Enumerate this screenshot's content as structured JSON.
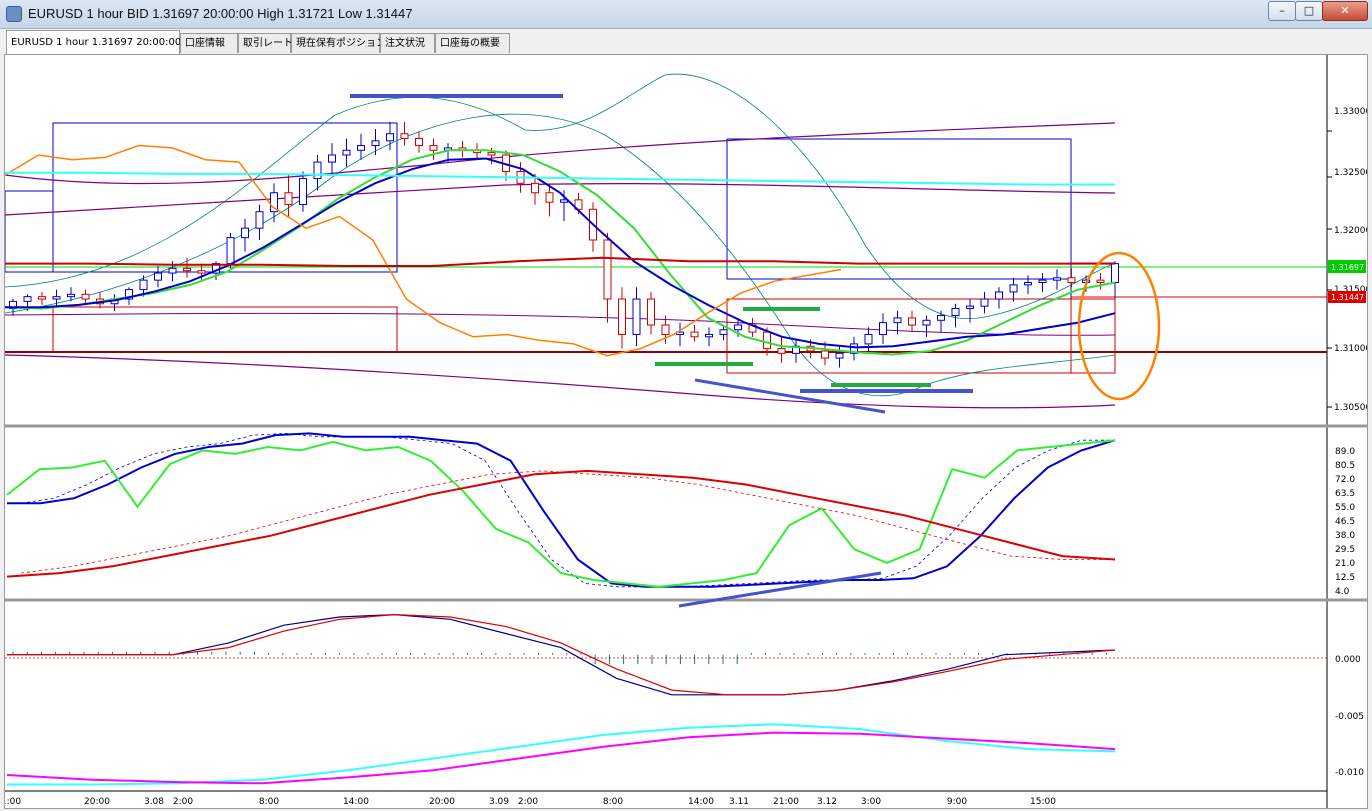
{
  "window": {
    "title": "EURUSD 1 hour BID 1.31697 20:00:00 High 1.31721 Low 1.31447",
    "minimize_label": "–",
    "maximize_label": "□",
    "close_label": "✕"
  },
  "tabs": [
    {
      "label": "EURUSD 1 hour 1.31697 20:00:00",
      "active": true
    },
    {
      "label": "口座情報",
      "active": false
    },
    {
      "label": "取引レート",
      "active": false
    },
    {
      "label": "現在保有ポジション",
      "active": false
    },
    {
      "label": "注文状況",
      "active": false
    },
    {
      "label": "口座毎の概要",
      "active": false
    }
  ],
  "price_axis": {
    "ticks": [
      "1.33000",
      "1.32500",
      "1.32000",
      "1.31500",
      "1.31000",
      "1.30500"
    ],
    "current_price_label": "1.31697",
    "low_price_label": "1.31447",
    "current_price_color": "#00cc00",
    "low_price_color": "#dd0000"
  },
  "stoch_axis": {
    "ticks": [
      "89.0",
      "80.5",
      "72.0",
      "63.5",
      "55.0",
      "46.5",
      "38.0",
      "29.5",
      "21.0",
      "12.5",
      "4.0"
    ]
  },
  "macd_axis": {
    "ticks": [
      "0.000",
      "-0.005",
      "-0.010"
    ]
  },
  "time_axis": {
    "labels": [
      "1:00",
      "20:00",
      "3.08",
      "2:00",
      "8:00",
      "14:00",
      "20:00",
      "3.09",
      "2:00",
      "8:00",
      "14:00",
      "3.11",
      "21:00",
      "3.12",
      "3:00",
      "9:00",
      "15:00"
    ]
  },
  "chart_data": [
    {
      "type": "candlestick",
      "title": "EURUSD 1 hour",
      "ylim": [
        1.3035,
        1.3345
      ],
      "series": [
        {
          "name": "ma-green",
          "color": "#33dd33",
          "values": [
            1.3133,
            1.3132,
            1.3135,
            1.314,
            1.3145,
            1.3152,
            1.3163,
            1.3182,
            1.3202,
            1.3225,
            1.3243,
            1.3258,
            1.3266,
            1.3266,
            1.3262,
            1.3248,
            1.3228,
            1.32,
            1.316,
            1.3124,
            1.3108,
            1.31,
            1.3098,
            1.3095,
            1.3093,
            1.3096,
            1.3105,
            1.312,
            1.3135,
            1.3148,
            1.3154
          ]
        },
        {
          "name": "ma-blue",
          "color": "#0000cc",
          "values": [
            1.3133,
            1.3133,
            1.3135,
            1.3139,
            1.3146,
            1.3155,
            1.3168,
            1.3184,
            1.3203,
            1.3222,
            1.3238,
            1.325,
            1.3258,
            1.3259,
            1.325,
            1.323,
            1.32,
            1.3172,
            1.3152,
            1.3135,
            1.312,
            1.3108,
            1.3102,
            1.3099,
            1.31,
            1.3104,
            1.3108,
            1.311,
            1.3115,
            1.312,
            1.3128
          ]
        },
        {
          "name": "orange-line",
          "color": "#ff8000",
          "values": [
            1.3245,
            1.3262,
            1.3258,
            1.326,
            1.327,
            1.3268,
            1.3258,
            1.3256,
            1.3218,
            1.32,
            1.321,
            1.319,
            1.314,
            1.312,
            1.3108,
            1.311,
            1.3105,
            1.3102,
            1.3092,
            1.3098,
            1.311,
            1.3128,
            1.3145,
            1.3155,
            1.316,
            1.3165
          ]
        },
        {
          "name": "cyan-level",
          "color": "#33ffff",
          "values": [
            1.3247,
            1.3247,
            1.3246,
            1.3246,
            1.3245,
            1.3244,
            1.3243,
            1.3242,
            1.3241,
            1.324,
            1.3239,
            1.3238,
            1.3237,
            1.3237
          ]
        },
        {
          "name": "red-level",
          "color": "#cc0000",
          "values": [
            1.317,
            1.317,
            1.3169,
            1.3169,
            1.3168,
            1.3168,
            1.3172,
            1.3175,
            1.3172,
            1.3172,
            1.317,
            1.317,
            1.317,
            1.317
          ]
        }
      ],
      "candles": [
        [
          1.3132,
          1.314,
          1.3126,
          1.3138
        ],
        [
          1.3138,
          1.3144,
          1.313,
          1.3142
        ],
        [
          1.3142,
          1.3146,
          1.3135,
          1.314
        ],
        [
          1.314,
          1.3148,
          1.3134,
          1.3142
        ],
        [
          1.3142,
          1.315,
          1.3138,
          1.3144
        ],
        [
          1.3144,
          1.3148,
          1.3136,
          1.314
        ],
        [
          1.314,
          1.3146,
          1.3132,
          1.3136
        ],
        [
          1.3136,
          1.3144,
          1.313,
          1.314
        ],
        [
          1.314,
          1.315,
          1.3135,
          1.3148
        ],
        [
          1.3148,
          1.316,
          1.3142,
          1.3156
        ],
        [
          1.3156,
          1.3168,
          1.315,
          1.3162
        ],
        [
          1.3162,
          1.3172,
          1.3155,
          1.3166
        ],
        [
          1.3166,
          1.3175,
          1.3158,
          1.3164
        ],
        [
          1.3164,
          1.317,
          1.3156,
          1.3162
        ],
        [
          1.3162,
          1.3172,
          1.3156,
          1.317
        ],
        [
          1.317,
          1.3196,
          1.3166,
          1.3192
        ],
        [
          1.3192,
          1.3208,
          1.318,
          1.32
        ],
        [
          1.32,
          1.322,
          1.319,
          1.3214
        ],
        [
          1.3214,
          1.3238,
          1.3205,
          1.323
        ],
        [
          1.323,
          1.3245,
          1.321,
          1.322
        ],
        [
          1.322,
          1.3248,
          1.3214,
          1.3242
        ],
        [
          1.3242,
          1.3262,
          1.3232,
          1.3256
        ],
        [
          1.3256,
          1.3272,
          1.3245,
          1.3262
        ],
        [
          1.3262,
          1.3276,
          1.3252,
          1.3266
        ],
        [
          1.3266,
          1.328,
          1.3258,
          1.327
        ],
        [
          1.327,
          1.3284,
          1.3262,
          1.3274
        ],
        [
          1.3274,
          1.329,
          1.3266,
          1.328
        ],
        [
          1.328,
          1.329,
          1.327,
          1.3276
        ],
        [
          1.3276,
          1.3282,
          1.3264,
          1.327
        ],
        [
          1.327,
          1.3276,
          1.3258,
          1.3266
        ],
        [
          1.3266,
          1.3272,
          1.3256,
          1.3268
        ],
        [
          1.3268,
          1.3274,
          1.326,
          1.3266
        ],
        [
          1.3266,
          1.3272,
          1.3258,
          1.3264
        ],
        [
          1.3264,
          1.3268,
          1.3254,
          1.3262
        ],
        [
          1.3262,
          1.3266,
          1.324,
          1.3248
        ],
        [
          1.3248,
          1.3256,
          1.323,
          1.3238
        ],
        [
          1.3238,
          1.3246,
          1.322,
          1.323
        ],
        [
          1.323,
          1.3238,
          1.321,
          1.3222
        ],
        [
          1.3222,
          1.3232,
          1.3206,
          1.3224
        ],
        [
          1.3224,
          1.323,
          1.3212,
          1.3216
        ],
        [
          1.3216,
          1.3222,
          1.318,
          1.319
        ],
        [
          1.319,
          1.3196,
          1.312,
          1.314
        ],
        [
          1.314,
          1.315,
          1.3098,
          1.311
        ],
        [
          1.311,
          1.315,
          1.31,
          1.314
        ],
        [
          1.314,
          1.3146,
          1.311,
          1.3118
        ],
        [
          1.3118,
          1.3126,
          1.3102,
          1.311
        ],
        [
          1.311,
          1.312,
          1.31,
          1.3112
        ],
        [
          1.3112,
          1.3118,
          1.3104,
          1.3108
        ],
        [
          1.3108,
          1.3116,
          1.31,
          1.311
        ],
        [
          1.311,
          1.3118,
          1.3105,
          1.3114
        ],
        [
          1.3114,
          1.3124,
          1.3108,
          1.3118
        ],
        [
          1.3118,
          1.3124,
          1.3108,
          1.3112
        ],
        [
          1.3112,
          1.3116,
          1.3092,
          1.3098
        ],
        [
          1.3098,
          1.3108,
          1.3086,
          1.3094
        ],
        [
          1.3094,
          1.3106,
          1.3086,
          1.31
        ],
        [
          1.31,
          1.3106,
          1.309,
          1.3096
        ],
        [
          1.3096,
          1.3104,
          1.3084,
          1.309
        ],
        [
          1.309,
          1.31,
          1.3082,
          1.3094
        ],
        [
          1.3094,
          1.3108,
          1.3088,
          1.3102
        ],
        [
          1.3102,
          1.3116,
          1.3094,
          1.311
        ],
        [
          1.311,
          1.3128,
          1.3102,
          1.312
        ],
        [
          1.312,
          1.313,
          1.311,
          1.3124
        ],
        [
          1.3124,
          1.313,
          1.3112,
          1.3118
        ],
        [
          1.3118,
          1.3126,
          1.3108,
          1.3122
        ],
        [
          1.3122,
          1.313,
          1.3112,
          1.3126
        ],
        [
          1.3126,
          1.3136,
          1.3116,
          1.3132
        ],
        [
          1.3132,
          1.314,
          1.312,
          1.3134
        ],
        [
          1.3134,
          1.3146,
          1.3128,
          1.314
        ],
        [
          1.314,
          1.315,
          1.3132,
          1.3146
        ],
        [
          1.3146,
          1.3158,
          1.3138,
          1.3152
        ],
        [
          1.3152,
          1.316,
          1.3144,
          1.3154
        ],
        [
          1.3154,
          1.3162,
          1.3146,
          1.3156
        ],
        [
          1.3156,
          1.3165,
          1.3148,
          1.3158
        ],
        [
          1.3158,
          1.3166,
          1.315,
          1.3154
        ],
        [
          1.3154,
          1.316,
          1.3146,
          1.3156
        ],
        [
          1.3156,
          1.3162,
          1.3148,
          1.3154
        ],
        [
          1.3154,
          1.3172,
          1.315,
          1.317
        ]
      ]
    },
    {
      "type": "line",
      "title": "Stochastic",
      "ylim": [
        0,
        98
      ],
      "series": [
        {
          "name": "stoch-main",
          "color": "#0000cc",
          "values": [
            55,
            55,
            58,
            66,
            76,
            84,
            88,
            90,
            95,
            96,
            94,
            94,
            94,
            92,
            90,
            80,
            50,
            22,
            8,
            6,
            6,
            6,
            7,
            8,
            9,
            10,
            10,
            11,
            18,
            36,
            58,
            76,
            86,
            92
          ]
        },
        {
          "name": "stoch-green",
          "color": "#33ee33",
          "values": [
            60,
            75,
            76,
            80,
            53,
            78,
            86,
            84,
            88,
            86,
            91,
            86,
            88,
            80,
            62,
            40,
            32,
            14,
            10,
            8,
            6,
            8,
            10,
            14,
            42,
            52,
            28,
            20,
            28,
            75,
            70,
            86,
            88,
            90,
            92
          ]
        },
        {
          "name": "stoch-red",
          "color": "#dd0000",
          "values": [
            12,
            14,
            18,
            24,
            30,
            36,
            44,
            52,
            60,
            66,
            72,
            74,
            72,
            70,
            66,
            60,
            54,
            48,
            40,
            32,
            24,
            22
          ]
        }
      ]
    },
    {
      "type": "line",
      "title": "MACD",
      "ylim": [
        -0.0113,
        0.0043
      ],
      "series": [
        {
          "name": "macd-blue",
          "color": "#000080",
          "values": [
            0.0,
            0.0,
            0.0,
            0.0,
            0.001,
            0.0025,
            0.0032,
            0.0034,
            0.003,
            0.0018,
            0.0006,
            -0.002,
            -0.0034,
            -0.0034,
            -0.0034,
            -0.003,
            -0.0022,
            -0.0012,
            0.0,
            0.0002,
            0.0004
          ]
        },
        {
          "name": "macd-red",
          "color": "#dd0000",
          "values": [
            0.0,
            0.0,
            0.0,
            0.0,
            0.0006,
            0.002,
            0.003,
            0.0034,
            0.0032,
            0.0024,
            0.001,
            -0.0012,
            -0.003,
            -0.0034,
            -0.0034,
            -0.003,
            -0.0023,
            -0.0014,
            -0.0004,
            0.0,
            0.0004
          ]
        },
        {
          "name": "cyan-line",
          "color": "#33ffff",
          "values": [
            -0.011,
            -0.011,
            -0.0109,
            -0.0106,
            -0.0098,
            -0.0088,
            -0.0078,
            -0.0068,
            -0.0062,
            -0.0059,
            -0.0063,
            -0.0073,
            -0.008,
            -0.0082
          ]
        },
        {
          "name": "magenta-line",
          "color": "#ff00ff",
          "values": [
            -0.0102,
            -0.0106,
            -0.0108,
            -0.0109,
            -0.0104,
            -0.0098,
            -0.0088,
            -0.0078,
            -0.007,
            -0.0066,
            -0.0067,
            -0.0071,
            -0.0075,
            -0.008
          ]
        }
      ]
    }
  ]
}
